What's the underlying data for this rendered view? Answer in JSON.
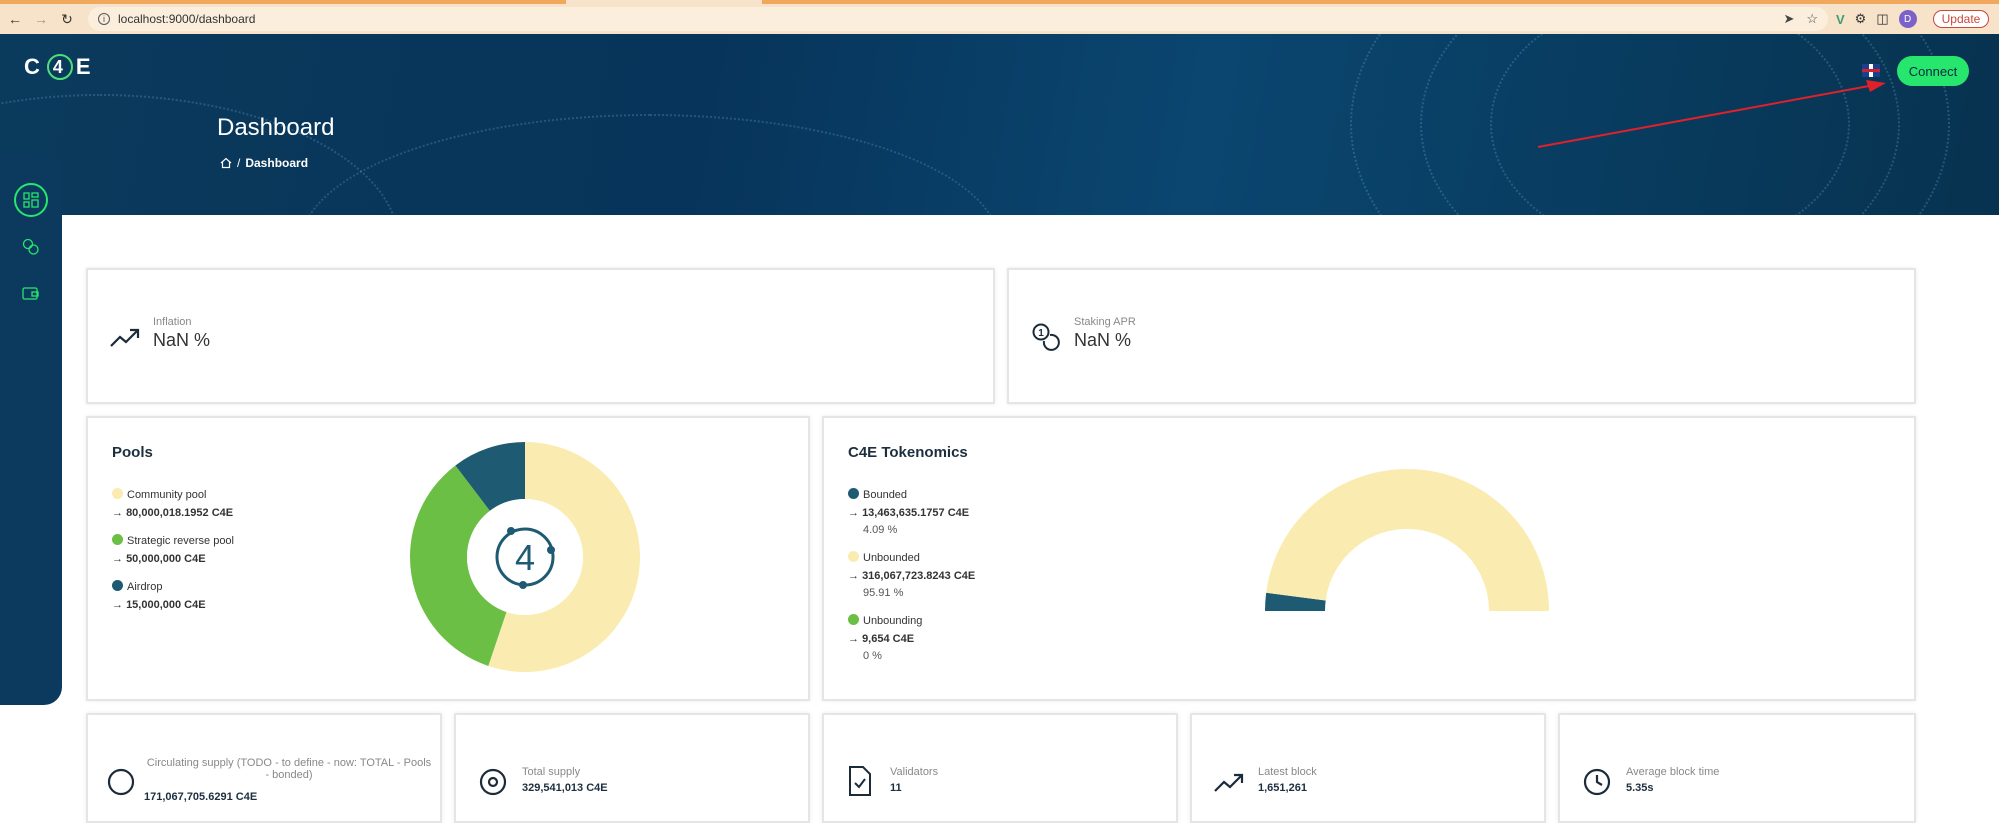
{
  "browser": {
    "url": "localhost:9000/dashboard",
    "profile_initial": "D",
    "update_label": "Update"
  },
  "header": {
    "logo_text": "C4E",
    "connect_label": "Connect",
    "page_title": "Dashboard",
    "breadcrumb_sep": "/",
    "breadcrumb_current": "Dashboard"
  },
  "sidebar": {
    "items": [
      {
        "icon": "dashboard-grid-icon",
        "active": true
      },
      {
        "icon": "staking-coins-icon",
        "active": false
      },
      {
        "icon": "wallet-icon",
        "active": false
      }
    ]
  },
  "stats_top": {
    "inflation": {
      "label": "Inflation",
      "value": "NaN %"
    },
    "staking_apr": {
      "label": "Staking APR",
      "value": "NaN %"
    }
  },
  "pools": {
    "title": "Pools",
    "items": [
      {
        "name": "Community pool",
        "value": "80,000,018.1952 C4E",
        "color": "#faecb0"
      },
      {
        "name": "Strategic reverse pool",
        "value": "50,000,000 C4E",
        "color": "#6cbf45"
      },
      {
        "name": "Airdrop",
        "value": "15,000,000 C4E",
        "color": "#1f5a73"
      }
    ],
    "chart_data": {
      "type": "pie",
      "categories": [
        "Community pool",
        "Strategic reverse pool",
        "Airdrop"
      ],
      "values": [
        80000018.1952,
        50000000,
        15000000
      ]
    }
  },
  "tokenomics": {
    "title": "C4E Tokenomics",
    "items": [
      {
        "name": "Bounded",
        "value": "13,463,635.1757 C4E",
        "percent": "4.09 %",
        "color": "#1f5a73"
      },
      {
        "name": "Unbounded",
        "value": "316,067,723.8243 C4E",
        "percent": "95.91 %",
        "color": "#faecb0"
      },
      {
        "name": "Unbounding",
        "value": "9,654 C4E",
        "percent": "0 %",
        "color": "#6cbf45"
      }
    ],
    "chart_data": {
      "type": "pie",
      "categories": [
        "Bounded",
        "Unbounded",
        "Unbounding"
      ],
      "values": [
        4.09,
        95.91,
        0
      ]
    }
  },
  "bottom_stats": {
    "circulating": {
      "label": "Circulating supply (TODO - to define - now: TOTAL - Pools - bonded)",
      "value": "171,067,705.6291 C4E"
    },
    "total_supply": {
      "label": "Total supply",
      "value": "329,541,013 C4E"
    },
    "validators": {
      "label": "Validators",
      "value": "11"
    },
    "latest_block": {
      "label": "Latest block",
      "value": "1,651,261"
    },
    "avg_block_time": {
      "label": "Average block time",
      "value": "5.35s"
    }
  },
  "colors": {
    "accent_green": "#27e66d",
    "navy": "#0b3a5e",
    "annotation_red": "#e0202a"
  }
}
